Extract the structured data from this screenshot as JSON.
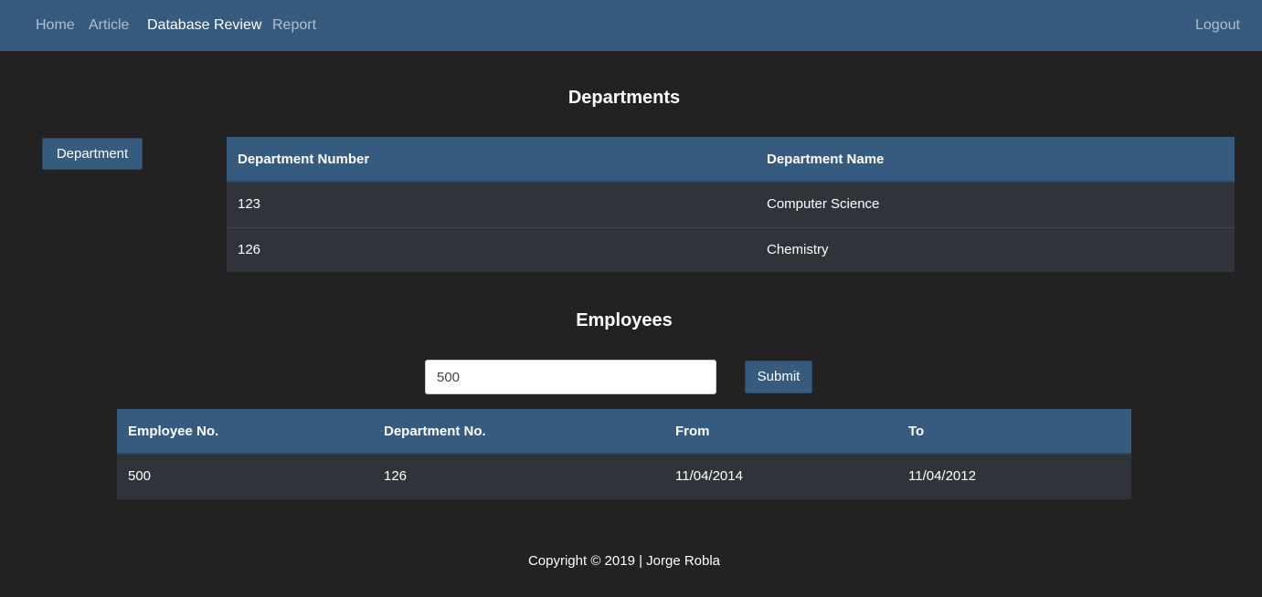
{
  "nav": {
    "items": [
      {
        "label": "Home"
      },
      {
        "label": "Article"
      },
      {
        "label": "Database Review"
      },
      {
        "label": "Report"
      }
    ],
    "logout_label": "Logout"
  },
  "departments": {
    "title": "Departments",
    "button_label": "Department",
    "columns": [
      "Department Number",
      "Department Name"
    ],
    "rows": [
      [
        "123",
        "Computer Science"
      ],
      [
        "126",
        "Chemistry"
      ]
    ]
  },
  "employees": {
    "title": "Employees",
    "search_value": "500",
    "submit_label": "Submit",
    "columns": [
      "Employee No.",
      "Department No.",
      "From",
      "To"
    ],
    "rows": [
      [
        "500",
        "126",
        "11/04/2014",
        "11/04/2012"
      ]
    ]
  },
  "footer": {
    "text": "Copyright © 2019 | Jorge Robla"
  },
  "colors": {
    "background": "#222222",
    "primary": "#375a7f",
    "row": "#30343a"
  }
}
